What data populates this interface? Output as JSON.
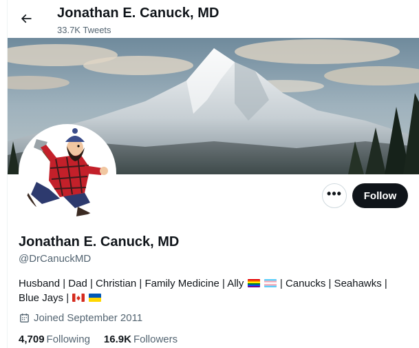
{
  "header": {
    "title": "Jonathan E. Canuck, MD",
    "tweet_count": "33.7K Tweets"
  },
  "profile": {
    "display_name": "Jonathan E. Canuck, MD",
    "handle": "@DrCanuckMD",
    "bio_part1": "Husband | Dad | Christian | Family Medicine | Ally",
    "bio_part2": "| Canucks | Seahawks |",
    "bio_part3": "Blue Jays |",
    "joined": "Joined September 2011",
    "following_count": "4,709",
    "following_label": "Following",
    "followers_count": "16.9K",
    "followers_label": "Followers"
  },
  "actions": {
    "more_label": "•••",
    "follow_label": "Follow"
  },
  "icons": {
    "back": "arrow-left-icon",
    "more": "more-horizontal-icon",
    "calendar": "calendar-icon"
  },
  "colors": {
    "primary_text": "#0f1419",
    "secondary_text": "#536471",
    "follow_bg": "#0f1419"
  }
}
